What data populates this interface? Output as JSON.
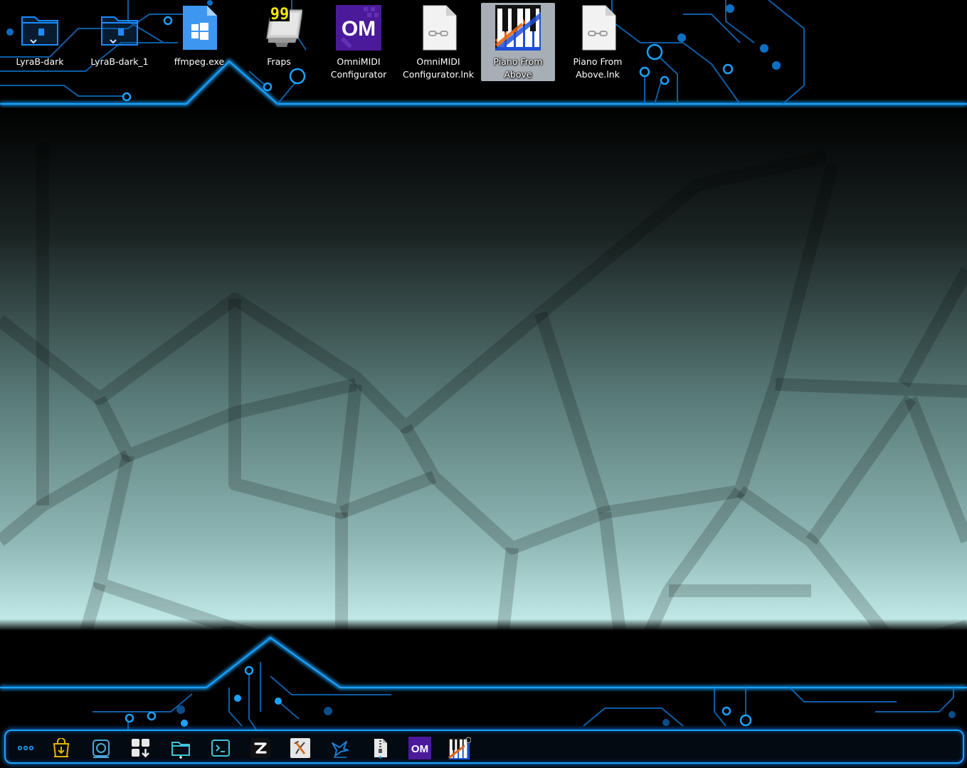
{
  "desktop": {
    "icons": [
      {
        "label": "LyraB-dark",
        "icon": "folder-icon"
      },
      {
        "label": "LyraB-dark_1",
        "icon": "folder-icon"
      },
      {
        "label": "ffmpeg.exe",
        "icon": "windows-exe-icon"
      },
      {
        "label": "Fraps",
        "icon": "fraps-icon",
        "badge": "99"
      },
      {
        "label": "OmniMIDI\nConfigurator",
        "icon": "omnimidi-icon",
        "badge": "OM"
      },
      {
        "label": "OmniMIDI\nConfigurator.lnk",
        "icon": "link-file-icon"
      },
      {
        "label": "Piano From\nAbove",
        "icon": "piano-icon",
        "selected": true
      },
      {
        "label": "Piano From\nAbove.lnk",
        "icon": "link-file-icon"
      }
    ]
  },
  "taskbar": {
    "items": [
      {
        "name": "app-menu",
        "icon": "dots-icon"
      },
      {
        "name": "kget",
        "icon": "download-bag-icon"
      },
      {
        "name": "screenshot",
        "icon": "camera-icon"
      },
      {
        "name": "discover",
        "icon": "app-store-icon"
      },
      {
        "name": "file-manager",
        "icon": "folder-icon"
      },
      {
        "name": "terminal",
        "icon": "terminal-icon"
      },
      {
        "name": "zed",
        "icon": "z-logo-icon"
      },
      {
        "name": "x-app",
        "icon": "x-logo-icon"
      },
      {
        "name": "kde-app",
        "icon": "bird-icon"
      },
      {
        "name": "archive",
        "icon": "zip-icon"
      },
      {
        "name": "omnimidi",
        "icon": "omnimidi-icon",
        "badge": "OM"
      },
      {
        "name": "piano-from-above",
        "icon": "piano-icon"
      }
    ]
  },
  "colors": {
    "accent": "#1aa2ff",
    "om_purple": "#4b1a9a",
    "fraps_yellow": "#f4e60a",
    "selection": "#cdd4de"
  }
}
